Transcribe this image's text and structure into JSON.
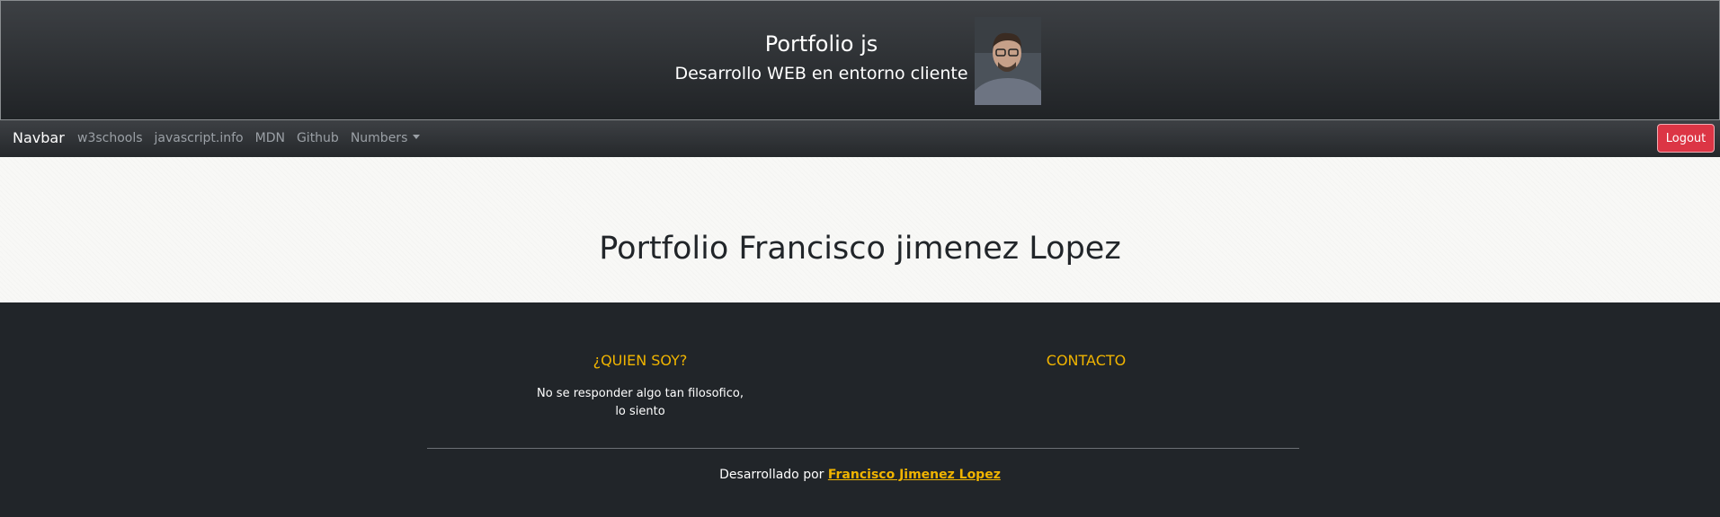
{
  "header": {
    "title": "Portfolio js",
    "subtitle": "Desarrollo WEB en entorno cliente"
  },
  "navbar": {
    "brand": "Navbar",
    "links": [
      {
        "label": "w3schools"
      },
      {
        "label": "javascript.info"
      },
      {
        "label": "MDN"
      },
      {
        "label": "Github"
      },
      {
        "label": "Numbers",
        "has_dropdown": true
      }
    ],
    "logout_label": "Logout"
  },
  "hero": {
    "title": "Portfolio Francisco jimenez Lopez"
  },
  "footer": {
    "about_heading": "¿QUIEN SOY?",
    "about_text": "No se responder algo tan filosofico, lo siento",
    "contact_heading": "CONTACTO",
    "credits_prefix": "Desarrollado por",
    "author_link": "Francisco Jimenez Lopez"
  },
  "colors": {
    "accent": "#f0b400",
    "logout": "#dc3545",
    "footer_bg": "#212529"
  }
}
